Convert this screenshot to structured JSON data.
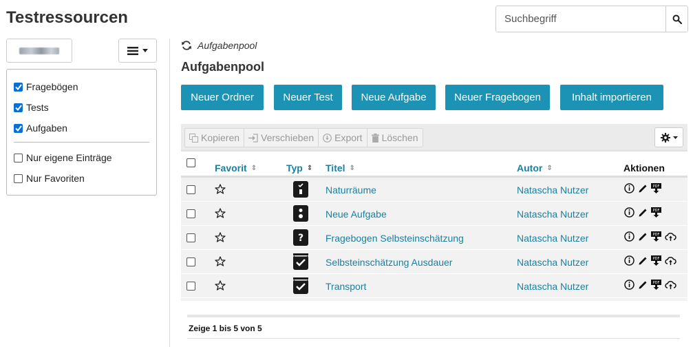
{
  "page": {
    "title": "Testressourcen"
  },
  "search": {
    "placeholder": "Suchbegriff"
  },
  "sidebar": {
    "filters": [
      {
        "label": "Fragebögen",
        "checked": true
      },
      {
        "label": "Tests",
        "checked": true
      },
      {
        "label": "Aufgaben",
        "checked": true
      },
      {
        "label": "Nur eigene Einträge",
        "checked": false
      },
      {
        "label": "Nur Favoriten",
        "checked": false
      }
    ]
  },
  "breadcrumb": {
    "label": "Aufgabenpool"
  },
  "main": {
    "title": "Aufgabenpool",
    "buttons": [
      "Neuer Ordner",
      "Neuer Test",
      "Neue Aufgabe",
      "Neuer Fragebogen",
      "Inhalt importieren"
    ],
    "toolbar": [
      "Kopieren",
      "Verschieben",
      "Export",
      "Löschen"
    ]
  },
  "table": {
    "headers": {
      "favorite": "Favorit",
      "type": "Typ",
      "title": "Titel",
      "author": "Autor",
      "actions": "Aktionen"
    },
    "rows": [
      {
        "type": "task",
        "title": "Naturräume",
        "author": "Natascha Nutzer",
        "cloud": false
      },
      {
        "type": "task",
        "title": "Neue Aufgabe",
        "author": "Natascha Nutzer",
        "cloud": false
      },
      {
        "type": "questionnaire",
        "title": "Fragebogen Selbsteinschätzung",
        "author": "Natascha Nutzer",
        "cloud": true
      },
      {
        "type": "test",
        "title": "Selbsteinschätzung Ausdauer",
        "author": "Natascha Nutzer",
        "cloud": true
      },
      {
        "type": "test",
        "title": "Transport",
        "author": "Natascha Nutzer",
        "cloud": true
      }
    ]
  },
  "pager": {
    "text": "Zeige 1 bis 5 von 5"
  },
  "colors": {
    "accent": "#1c93b5",
    "link": "#1a7fa0",
    "checkbox": "#0a6fd0"
  }
}
